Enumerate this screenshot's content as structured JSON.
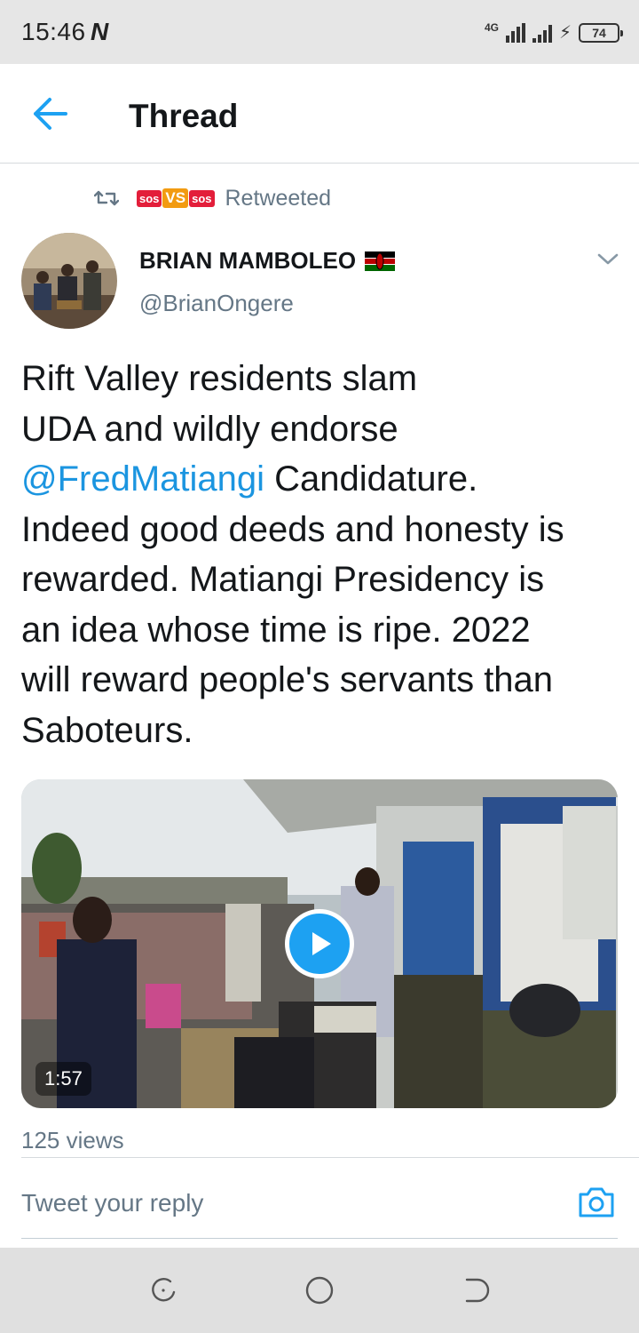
{
  "status_bar": {
    "time": "15:46",
    "carrier_icon": "N",
    "network": "4G",
    "battery": "74"
  },
  "header": {
    "title": "Thread"
  },
  "retweet": {
    "by_logo": [
      "sos",
      "VS",
      "sos"
    ],
    "label": "Retweeted"
  },
  "author": {
    "name": "BRIAN MAMBOLEO",
    "handle": "@BrianOngere",
    "flag": "kenya-flag"
  },
  "tweet": {
    "text_before": "Rift Valley residents slam\nUDA and wildly endorse\n",
    "mention": "@FredMatiangi",
    "text_after": " Candidature.\nIndeed good deeds and honesty is\nrewarded. Matiangi Presidency is\nan idea whose time is ripe. 2022\nwill reward people's servants than\nSaboteurs."
  },
  "video": {
    "duration": "1:57"
  },
  "stats": {
    "views": "125 views"
  },
  "reply": {
    "placeholder": "Tweet your reply"
  },
  "colors": {
    "accent": "#1da1f2",
    "link": "#1b95e0",
    "secondary_text": "#657786"
  }
}
